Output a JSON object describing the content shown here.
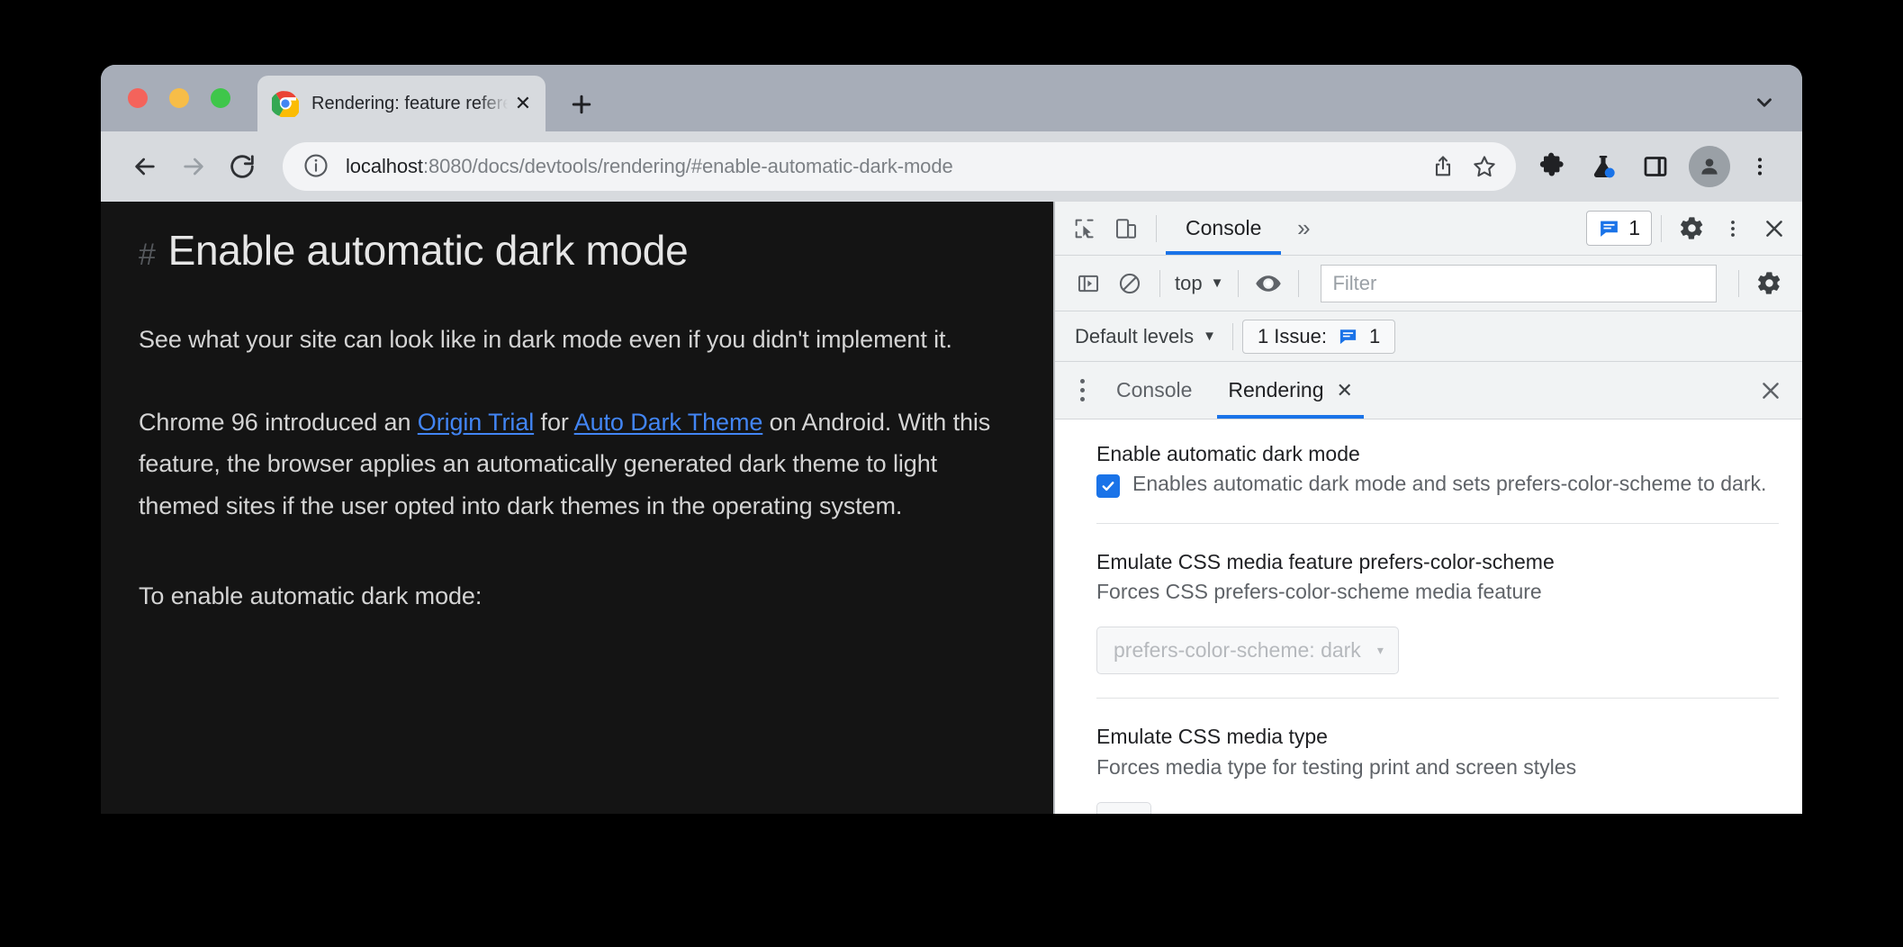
{
  "browser": {
    "window_controls": [
      "close",
      "minimize",
      "maximize"
    ],
    "tab": {
      "title": "Rendering: feature reference -",
      "favicon": "chrome-logo-icon",
      "close_label": "✕"
    },
    "new_tab_label": "+",
    "tab_search_icon": "chevron-down-icon",
    "toolbar": {
      "back_icon": "arrow-left-icon",
      "forward_icon": "arrow-right-icon",
      "reload_icon": "reload-icon",
      "site_info_icon": "info-circle-icon",
      "url_host": "localhost",
      "url_rest": ":8080/docs/devtools/rendering/#enable-automatic-dark-mode",
      "url_full": "localhost:8080/docs/devtools/rendering/#enable-automatic-dark-mode",
      "share_icon": "share-icon",
      "bookmark_icon": "star-icon",
      "extensions_icon": "puzzle-icon",
      "experiments_icon": "flask-icon",
      "side_panel_icon": "side-panel-icon",
      "profile_icon": "avatar-icon",
      "menu_icon": "kebab-menu-icon"
    }
  },
  "page": {
    "anchor": "#",
    "heading": "Enable automatic dark mode",
    "paragraph1": "See what your site can look like in dark mode even if you didn't implement it.",
    "paragraph2": {
      "part1": "Chrome 96 introduced an ",
      "link1": "Origin Trial",
      "part2": " for ",
      "link2": "Auto Dark Theme",
      "part3": " on Android. With this feature, the browser applies an automatically generated dark theme to light themed sites if the user opted into dark themes in the operating system."
    },
    "paragraph3": "To enable automatic dark mode:"
  },
  "devtools": {
    "main_toolbar": {
      "inspect_icon": "inspect-element-icon",
      "device_toggle_icon": "device-toolbar-icon",
      "active_tab": "Console",
      "overflow_label": "»",
      "issues_count": "1",
      "issues_icon": "issue-message-icon",
      "settings_icon": "gear-icon",
      "more_icon": "kebab-menu-icon",
      "close_icon": "close-icon"
    },
    "console_toolbar": {
      "sidebar_icon": "console-sidebar-icon",
      "clear_icon": "clear-console-icon",
      "context": "top",
      "context_caret": "▼",
      "eye_icon": "live-expression-icon",
      "filter_placeholder": "Filter",
      "filter_value": "",
      "settings_icon": "gear-icon"
    },
    "levels_bar": {
      "levels_label": "Default levels",
      "levels_caret": "▼",
      "issue_text": "1 Issue:",
      "issue_icon": "issue-message-icon",
      "issue_count": "1"
    },
    "drawer_tabs": {
      "menu_icon": "kebab-menu-icon",
      "tabs": [
        {
          "label": "Console",
          "active": false,
          "closable": false
        },
        {
          "label": "Rendering",
          "active": true,
          "closable": true,
          "close_label": "✕"
        }
      ],
      "close_icon": "close-icon"
    },
    "rendering": {
      "sections": [
        {
          "title": "Enable automatic dark mode",
          "description": "Enables automatic dark mode and sets prefers-color-scheme to dark.",
          "control": "checkbox",
          "checked": true
        },
        {
          "title": "Emulate CSS media feature prefers-color-scheme",
          "description": "Forces CSS prefers-color-scheme media feature",
          "control": "select",
          "value": "prefers-color-scheme: dark",
          "disabled": true,
          "caret": "▾"
        },
        {
          "title": "Emulate CSS media type",
          "description": "Forces media type for testing print and screen styles",
          "control": "select",
          "value": "",
          "disabled": false,
          "caret": "▾"
        }
      ]
    }
  },
  "colors": {
    "accent_blue": "#1a73e8",
    "link_blue": "#4285f4",
    "page_bg": "#141414",
    "devtools_bg": "#ffffff",
    "toolbar_bg": "#f1f3f4",
    "window_chrome": "#a7adb8"
  }
}
